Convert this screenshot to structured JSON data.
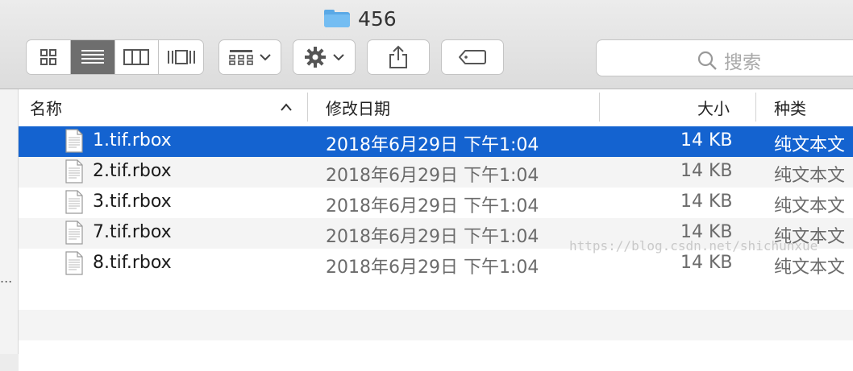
{
  "window": {
    "title": "456",
    "title_icon": "folder-icon"
  },
  "toolbar": {
    "view_modes": [
      {
        "name": "icon-view-icon",
        "active": false
      },
      {
        "name": "list-view-icon",
        "active": true
      },
      {
        "name": "column-view-icon",
        "active": false
      },
      {
        "name": "cover-flow-icon",
        "active": false
      }
    ],
    "arrange_icon": "grid-arrange-icon",
    "action_icon": "gear-icon",
    "share_icon": "share-icon",
    "tag_icon": "tag-icon",
    "search": {
      "placeholder": "搜索",
      "icon": "search-icon"
    }
  },
  "columns": {
    "name": "名称",
    "date": "修改日期",
    "size": "大小",
    "kind": "种类",
    "sort_indicator": "chevron-up-icon"
  },
  "files": [
    {
      "name": "1.tif.rbox",
      "date": "2018年6月29日 下午1:04",
      "size": "14 KB",
      "kind": "纯文本文",
      "selected": true
    },
    {
      "name": "2.tif.rbox",
      "date": "2018年6月29日 下午1:04",
      "size": "14 KB",
      "kind": "纯文本文",
      "selected": false
    },
    {
      "name": "3.tif.rbox",
      "date": "2018年6月29日 下午1:04",
      "size": "14 KB",
      "kind": "纯文本文",
      "selected": false
    },
    {
      "name": "7.tif.rbox",
      "date": "2018年6月29日 下午1:04",
      "size": "14 KB",
      "kind": "纯文本文",
      "selected": false
    },
    {
      "name": "8.tif.rbox",
      "date": "2018年6月29日 下午1:04",
      "size": "14 KB",
      "kind": "纯文本文",
      "selected": false
    }
  ],
  "sidebar": {
    "overflow_text": "..."
  },
  "watermark": "https://blog.csdn.net/shichunxue",
  "colors": {
    "selection": "#1463d0",
    "folder": "#5aa9e6"
  }
}
